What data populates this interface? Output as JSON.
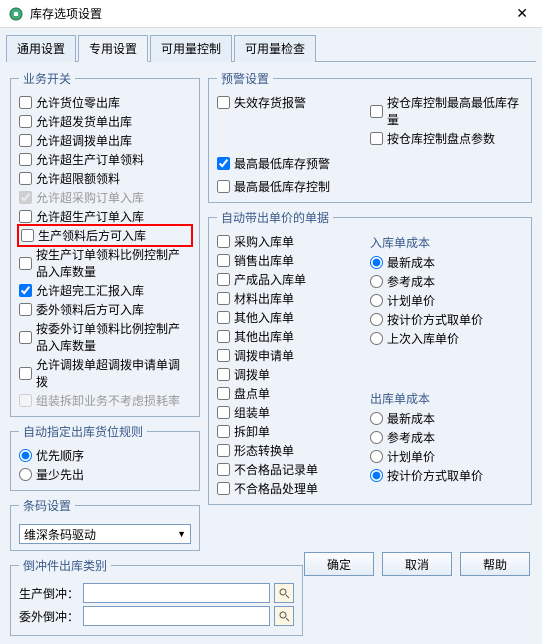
{
  "window": {
    "title": "库存选项设置"
  },
  "tabs": {
    "t1": "通用设置",
    "t2": "专用设置",
    "t3": "可用量控制",
    "t4": "可用量检查"
  },
  "left": {
    "bizSwitch": {
      "legend": "业务开关",
      "opts": {
        "o1": "允许货位零出库",
        "o2": "允许超发货单出库",
        "o3": "允许超调拨单出库",
        "o4": "允许超生产订单领料",
        "o5": "允许超限额领料",
        "o6": "允许超采购订单入库",
        "o7": "允许超生产订单入库",
        "o8": "生产领料后方可入库",
        "o9": "按生产订单领料比例控制产品入库数量",
        "o10": "允许超完工汇报入库",
        "o11": "委外领料后方可入库",
        "o12": "按委外订单领料比例控制产品入库数量",
        "o13": "允许调拨单超调拨申请单调拨",
        "o14": "组装拆卸业务不考虑损耗率"
      }
    },
    "autoLoc": {
      "legend": "自动指定出库货位规则",
      "r1": "优先顺序",
      "r2": "量少先出"
    },
    "barcode": {
      "legend": "条码设置",
      "driver": "维深条码驱动"
    },
    "offset": {
      "legend": "倒冲件出库类别",
      "l1": "生产倒冲：",
      "l2": "委外倒冲："
    }
  },
  "right": {
    "warn": {
      "legend": "预警设置",
      "c1": "失效存货报警",
      "c2": "按仓库控制最高最低库存量",
      "c3": "按仓库控制盘点参数",
      "c4": "最高最低库存预警",
      "c5": "最高最低库存控制"
    },
    "autoPrice": {
      "legend": "自动带出单价的单据",
      "col1": {
        "d1": "采购入库单",
        "d2": "销售出库单",
        "d3": "产成品入库单",
        "d4": "材料出库单",
        "d5": "其他入库单",
        "d6": "其他出库单",
        "d7": "调拨申请单",
        "d8": "调拨单",
        "d9": "盘点单",
        "d10": "组装单",
        "d11": "拆卸单",
        "d12": "形态转换单",
        "d13": "不合格品记录单",
        "d14": "不合格品处理单"
      },
      "inCost": {
        "title": "入库单成本",
        "r1": "最新成本",
        "r2": "参考成本",
        "r3": "计划单价",
        "r4": "按计价方式取单价",
        "r5": "上次入库单价"
      },
      "outCost": {
        "title": "出库单成本",
        "r1": "最新成本",
        "r2": "参考成本",
        "r3": "计划单价",
        "r4": "按计价方式取单价"
      }
    }
  },
  "footer": {
    "ok": "确定",
    "cancel": "取消",
    "help": "帮助"
  }
}
